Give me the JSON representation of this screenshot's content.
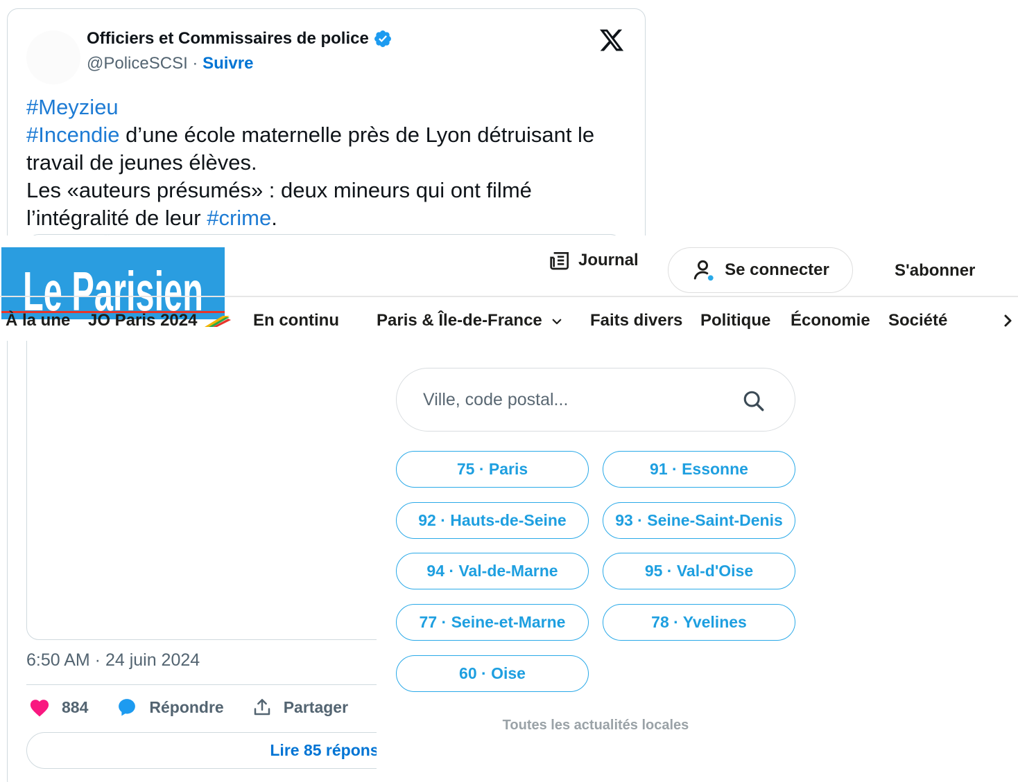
{
  "tweet": {
    "author_name": "Officiers et Commissaires de police",
    "handle": "@PoliceSCSI",
    "separator": " · ",
    "follow_label": "Suivre",
    "text": {
      "hashtag_1": "#Meyzieu",
      "hashtag_2": "#Incendie",
      "line_2": " d’une école maternelle près de Lyon détruisant le travail de jeunes élèves.",
      "line_3": "Les «auteurs présumés» : deux mineurs qui ont filmé l’intégralité de leur ",
      "hashtag_3": "#crime",
      "end_punct": "."
    },
    "timestamp": "6:50 AM · 24 juin 2024",
    "like_count": "884",
    "reply_label": "Répondre",
    "share_label": "Partager",
    "read_replies_label": "Lire 85 répons",
    "colors": {
      "like": "#f91880",
      "reply": "#1d9bf0",
      "link": "#1d7bd4"
    }
  },
  "parisien": {
    "logo_text": "Le Parisien",
    "header": {
      "journal_label": "Journal",
      "connect_label": "Se connecter",
      "subscribe_label": "S'abonner"
    },
    "nav": {
      "items": [
        "À la une",
        "JO Paris 2024",
        "En continu",
        "Paris & Île-de-France",
        "Faits divers",
        "Politique",
        "Économie",
        "Société"
      ]
    },
    "search": {
      "placeholder": "Ville, code postal..."
    },
    "departments": [
      "75 · Paris",
      "91 · Essonne",
      "92 · Hauts-de-Seine",
      "93 · Seine-Saint-Denis",
      "94 · Val-de-Marne",
      "95 · Val-d'Oise",
      "77 · Seine-et-Marne",
      "78 · Yvelines",
      "60 · Oise"
    ],
    "all_local_label": "Toutes les actualités locales",
    "colors": {
      "brand_blue": "#2a9de0",
      "dept_text": "#1e9fe0",
      "dept_border": "#29a9e8"
    }
  }
}
